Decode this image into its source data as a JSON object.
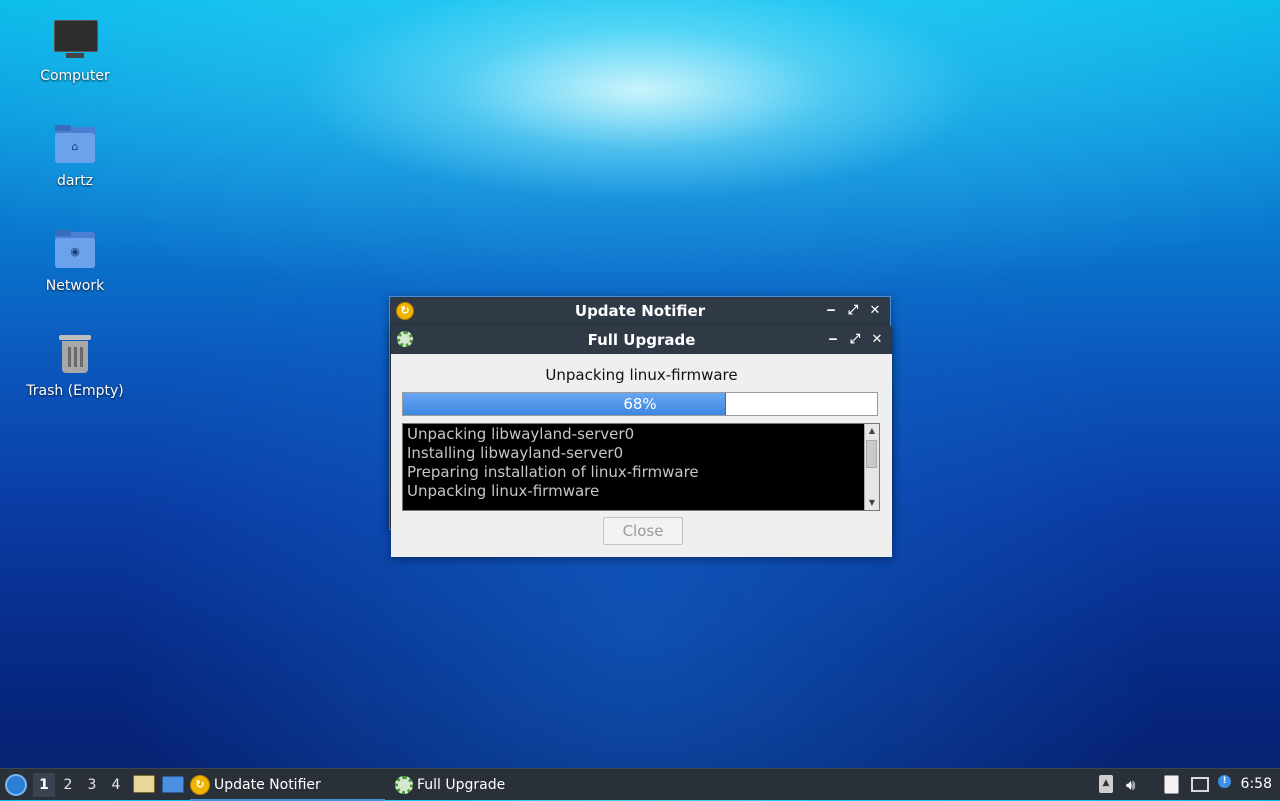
{
  "desktop": {
    "icons": [
      {
        "label": "Computer",
        "icon": "monitor-icon"
      },
      {
        "label": "dartz",
        "icon": "home-folder-icon"
      },
      {
        "label": "Network",
        "icon": "network-folder-icon"
      },
      {
        "label": "Trash (Empty)",
        "icon": "trash-icon"
      }
    ]
  },
  "update_notifier_window": {
    "title": "Update Notifier",
    "icon": "update-notifier-icon"
  },
  "full_upgrade_window": {
    "title": "Full Upgrade",
    "icon": "gear-icon",
    "status": "Unpacking linux-firmware",
    "progress_percent": 68,
    "progress_label": "68%",
    "log_lines": [
      "Unpacking libwayland-server0",
      "Installing libwayland-server0",
      "Preparing installation of linux-firmware",
      "Unpacking linux-firmware"
    ],
    "close_label": "Close"
  },
  "window_controls": {
    "minimize": "‒",
    "maximize": "⤢",
    "close": "✕"
  },
  "taskbar": {
    "workspaces": [
      "1",
      "2",
      "3",
      "4"
    ],
    "active_workspace": "1",
    "tasks": [
      {
        "label": "Update Notifier",
        "icon": "update-notifier-icon"
      },
      {
        "label": "Full Upgrade",
        "icon": "gear-icon"
      }
    ],
    "clock": "6:58"
  },
  "colors": {
    "titlebar": "#2f3a46",
    "progress_fill": "#3e86e0",
    "taskbar": "#2a3038"
  }
}
